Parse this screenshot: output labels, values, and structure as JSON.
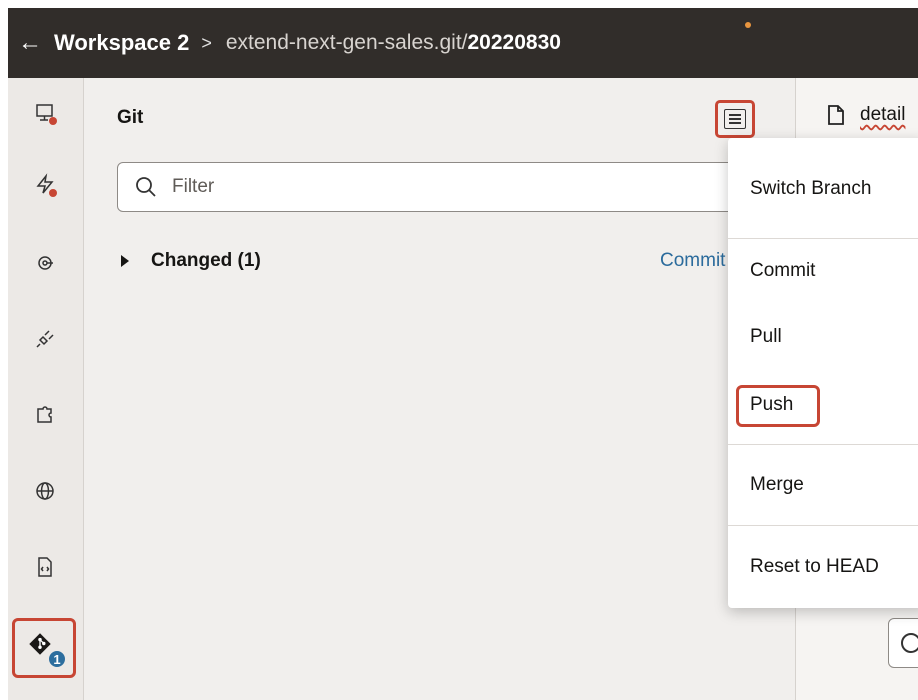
{
  "header": {
    "back_label": "←",
    "workspace": "Workspace 2",
    "separator": ">",
    "path_prefix": "extend-next-gen-sales.git/",
    "path_branch": "20220830"
  },
  "rail": {
    "icons": [
      "monitor-icon",
      "lightning-icon",
      "service-connection-icon",
      "plug-icon",
      "puzzle-icon",
      "globe-icon",
      "code-file-icon",
      "git-icon"
    ],
    "git_badge": "1"
  },
  "panel": {
    "title": "Git",
    "filter_placeholder": "Filter",
    "changed_label": "Changed (1)",
    "commit_link": "Commit ..."
  },
  "editor": {
    "tab_label": "detail"
  },
  "menu": {
    "items": [
      "Switch Branch",
      "Commit",
      "Pull",
      "Push",
      "Merge",
      "Reset to HEAD"
    ]
  },
  "colors": {
    "header_bg": "#312d2a",
    "highlight": "#c74634",
    "link": "#2b6b9c",
    "badge": "#2d6e9e"
  }
}
